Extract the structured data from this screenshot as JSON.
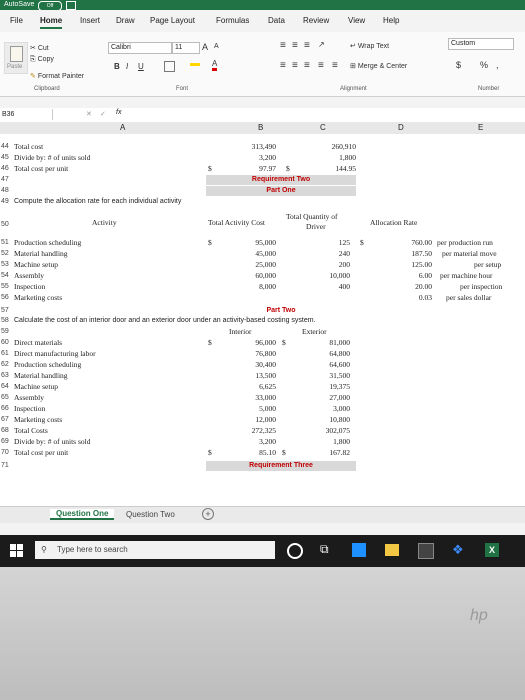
{
  "titlebar": {
    "autosave": "AutoSave",
    "toggle": "Off"
  },
  "tabs": [
    "File",
    "Home",
    "Insert",
    "Draw",
    "Page Layout",
    "Formulas",
    "Data",
    "Review",
    "View",
    "Help"
  ],
  "ribbon": {
    "cut": "Cut",
    "copy": "Copy",
    "paste": "Paste",
    "format_painter": "Format Painter",
    "font_name": "Calibri",
    "font_size": "11",
    "wrap_text": "Wrap Text",
    "merge_center": "Merge & Center",
    "number_format": "Custom",
    "currency": "$",
    "percent": "%",
    "groups": {
      "clipboard": "Clipboard",
      "font": "Font",
      "alignment": "Alignment",
      "number": "Number"
    }
  },
  "formula_bar": {
    "name_box": "B36",
    "fx": "fx",
    "value": ""
  },
  "columns": [
    "A",
    "B",
    "C",
    "D",
    "E"
  ],
  "sheet": {
    "r44": {
      "n": "44",
      "a": "Total cost",
      "b": "313,490",
      "c": "260,910"
    },
    "r45": {
      "n": "45",
      "a": "Divide by: # of units sold",
      "b": "3,200",
      "c": "1,800"
    },
    "r46": {
      "n": "46",
      "a": "Total cost per unit",
      "d1": "$",
      "b": "97.97",
      "d2": "$",
      "c": "144.95"
    },
    "r47": {
      "n": "47",
      "label": "Requirement Two"
    },
    "r48": {
      "n": "48",
      "label": "Part One"
    },
    "r49": {
      "n": "49",
      "a": "Compute the allocation rate for each individual activity"
    },
    "r50": {
      "n": "50",
      "activity": "Activity",
      "tac": "Total Activity Cost",
      "tqd1": "Total Quantity of",
      "tqd2": "Driver",
      "ar": "Allocation Rate"
    },
    "alloc": [
      {
        "n": "51",
        "name": "Production scheduling",
        "d1": "$",
        "cost": "95,000",
        "qty": "125",
        "d2": "$",
        "rate": "760.00",
        "per": "per production run"
      },
      {
        "n": "52",
        "name": "Material handling",
        "d1": "",
        "cost": "45,000",
        "qty": "240",
        "d2": "",
        "rate": "187.50",
        "per": "per material move"
      },
      {
        "n": "53",
        "name": "Machine setup",
        "d1": "",
        "cost": "25,000",
        "qty": "200",
        "d2": "",
        "rate": "125.00",
        "per": "per setup"
      },
      {
        "n": "54",
        "name": "Assembly",
        "d1": "",
        "cost": "60,000",
        "qty": "10,000",
        "d2": "",
        "rate": "6.00",
        "per": "per machine hour"
      },
      {
        "n": "55",
        "name": "Inspection",
        "d1": "",
        "cost": "8,000",
        "qty": "400",
        "d2": "",
        "rate": "20.00",
        "per": "per inspection"
      },
      {
        "n": "56",
        "name": "Marketing costs",
        "d1": "",
        "cost": "",
        "qty": "",
        "d2": "",
        "rate": "0.03",
        "per": "per sales dollar"
      }
    ],
    "r57": {
      "n": "57",
      "label": "Part Two"
    },
    "r58": {
      "n": "58",
      "a": "Calculate the cost of an interior door and an exterior door under an activity-based costing system."
    },
    "r59": {
      "n": "59",
      "interior": "Interior",
      "exterior": "Exterior"
    },
    "costs": [
      {
        "n": "60",
        "name": "Direct materials",
        "d1": "$",
        "int": "96,000",
        "d2": "$",
        "ext": "81,000"
      },
      {
        "n": "61",
        "name": "Direct manufacturing labor",
        "d1": "",
        "int": "76,800",
        "d2": "",
        "ext": "64,800"
      },
      {
        "n": "62",
        "name": "Production scheduling",
        "d1": "",
        "int": "30,400",
        "d2": "",
        "ext": "64,600"
      },
      {
        "n": "63",
        "name": "Material handling",
        "d1": "",
        "int": "13,500",
        "d2": "",
        "ext": "31,500"
      },
      {
        "n": "64",
        "name": "Machine setup",
        "d1": "",
        "int": "6,625",
        "d2": "",
        "ext": "19,375"
      },
      {
        "n": "65",
        "name": "Assembly",
        "d1": "",
        "int": "33,000",
        "d2": "",
        "ext": "27,000"
      },
      {
        "n": "66",
        "name": "Inspection",
        "d1": "",
        "int": "5,000",
        "d2": "",
        "ext": "3,000"
      },
      {
        "n": "67",
        "name": "Marketing costs",
        "d1": "",
        "int": "12,000",
        "d2": "",
        "ext": "10,800"
      },
      {
        "n": "68",
        "name": "Total Costs",
        "d1": "",
        "int": "272,325",
        "d2": "",
        "ext": "302,075"
      },
      {
        "n": "69",
        "name": "Divide by: # of units sold",
        "d1": "",
        "int": "3,200",
        "d2": "",
        "ext": "1,800"
      },
      {
        "n": "70",
        "name": "Total cost per unit",
        "d1": "$",
        "int": "85.10",
        "d2": "$",
        "ext": "167.82"
      }
    ],
    "r71": {
      "n": "71",
      "label": "Requirement Three"
    }
  },
  "sheet_tabs": [
    "Question One",
    "Question Two"
  ],
  "taskbar": {
    "search_placeholder": "Type here to search"
  },
  "colors": {
    "excel_green": "#217346",
    "requirement_red": "#c00000",
    "band_gray": "#d9d9d9"
  }
}
